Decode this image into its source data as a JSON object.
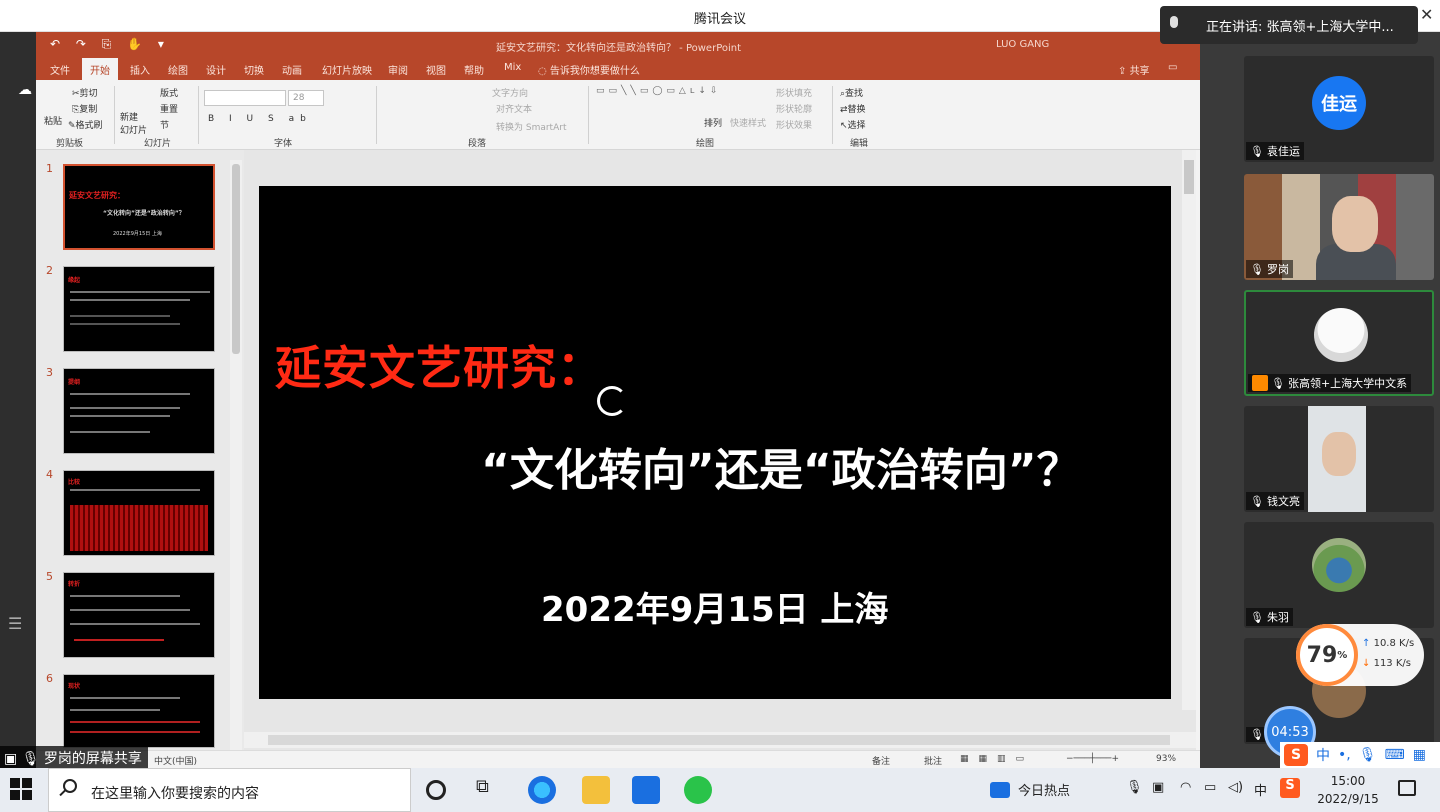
{
  "meeting": {
    "window_title": "腾讯会议",
    "speaking_banner": "正在讲话: 张高领+上海大学中...",
    "share_label": "罗岗的屏幕共享",
    "close": "✕"
  },
  "powerpoint": {
    "doc_title": "延安文艺研究：文化转向还是政治转向？ - PowerPoint",
    "user": "LUO GANG",
    "quick_access": "↶ ↷ ⎘ ✋ ▾",
    "tabs": [
      "文件",
      "开始",
      "插入",
      "绘图",
      "设计",
      "切换",
      "动画",
      "幻灯片放映",
      "审阅",
      "视图",
      "帮助",
      "Mix"
    ],
    "active_tab": "开始",
    "tell_me": "告诉我你想要做什么",
    "share": "共享",
    "ribbon": {
      "paste": "粘贴",
      "cut": "剪切",
      "copy": "复制",
      "format_painter": "格式刷",
      "clipboard_group": "剪贴板",
      "new_slide": "新建\n幻灯片",
      "layout": "版式",
      "reset": "重置",
      "section": "节",
      "slides_group": "幻灯片",
      "font_size": "28",
      "font_group": "字体",
      "text_direction": "文字方向",
      "align_text": "对齐文本",
      "smartart": "转换为 SmartArt",
      "paragraph_group": "段落",
      "arrange": "排列",
      "quick_styles": "快速样式",
      "shape_fill": "形状填充",
      "shape_outline": "形状轮廓",
      "shape_effects": "形状效果",
      "drawing_group": "绘图",
      "find": "查找",
      "replace": "替换",
      "select": "选择",
      "editing_group": "编辑"
    },
    "slide": {
      "title": "延安文艺研究：",
      "subtitle": "“文化转向”还是“政治转向”？",
      "date_place": "2022年9月15日  上海"
    },
    "thumbnails": [
      {
        "num": "1",
        "title": "延安文艺研究：",
        "line": "“文化转向”还是“政治转向”？",
        "date": "2022年9月15日  上海"
      },
      {
        "num": "2",
        "title": "缘起"
      },
      {
        "num": "3",
        "title": "提纲"
      },
      {
        "num": "4",
        "title": "比较"
      },
      {
        "num": "5",
        "title": "转折"
      },
      {
        "num": "6",
        "title": "现状"
      }
    ],
    "status": {
      "language": "中文(中国)",
      "notes": "备注",
      "comments": "批注",
      "zoom": "93%"
    }
  },
  "participants": [
    {
      "name": "袁佳运",
      "avatar_text": "佳运",
      "avatar_color": "#1877f2"
    },
    {
      "name": "罗岗"
    },
    {
      "name": "张高领+上海大学中文系",
      "active": true
    },
    {
      "name": "钱文亮"
    },
    {
      "name": "朱羽"
    },
    {
      "name": ""
    }
  ],
  "network_widget": {
    "percent": "79",
    "percent_unit": "%",
    "up": "10.8",
    "up_unit": "K/s",
    "down": "113",
    "down_unit": "K/s"
  },
  "timer": "04:53",
  "ime": {
    "logo": "S",
    "mode": "中"
  },
  "taskbar": {
    "search_placeholder": "在这里输入你要搜索的内容",
    "news": "今日热点",
    "ime_lang": "中",
    "time": "15:00",
    "date": "2022/9/15"
  }
}
